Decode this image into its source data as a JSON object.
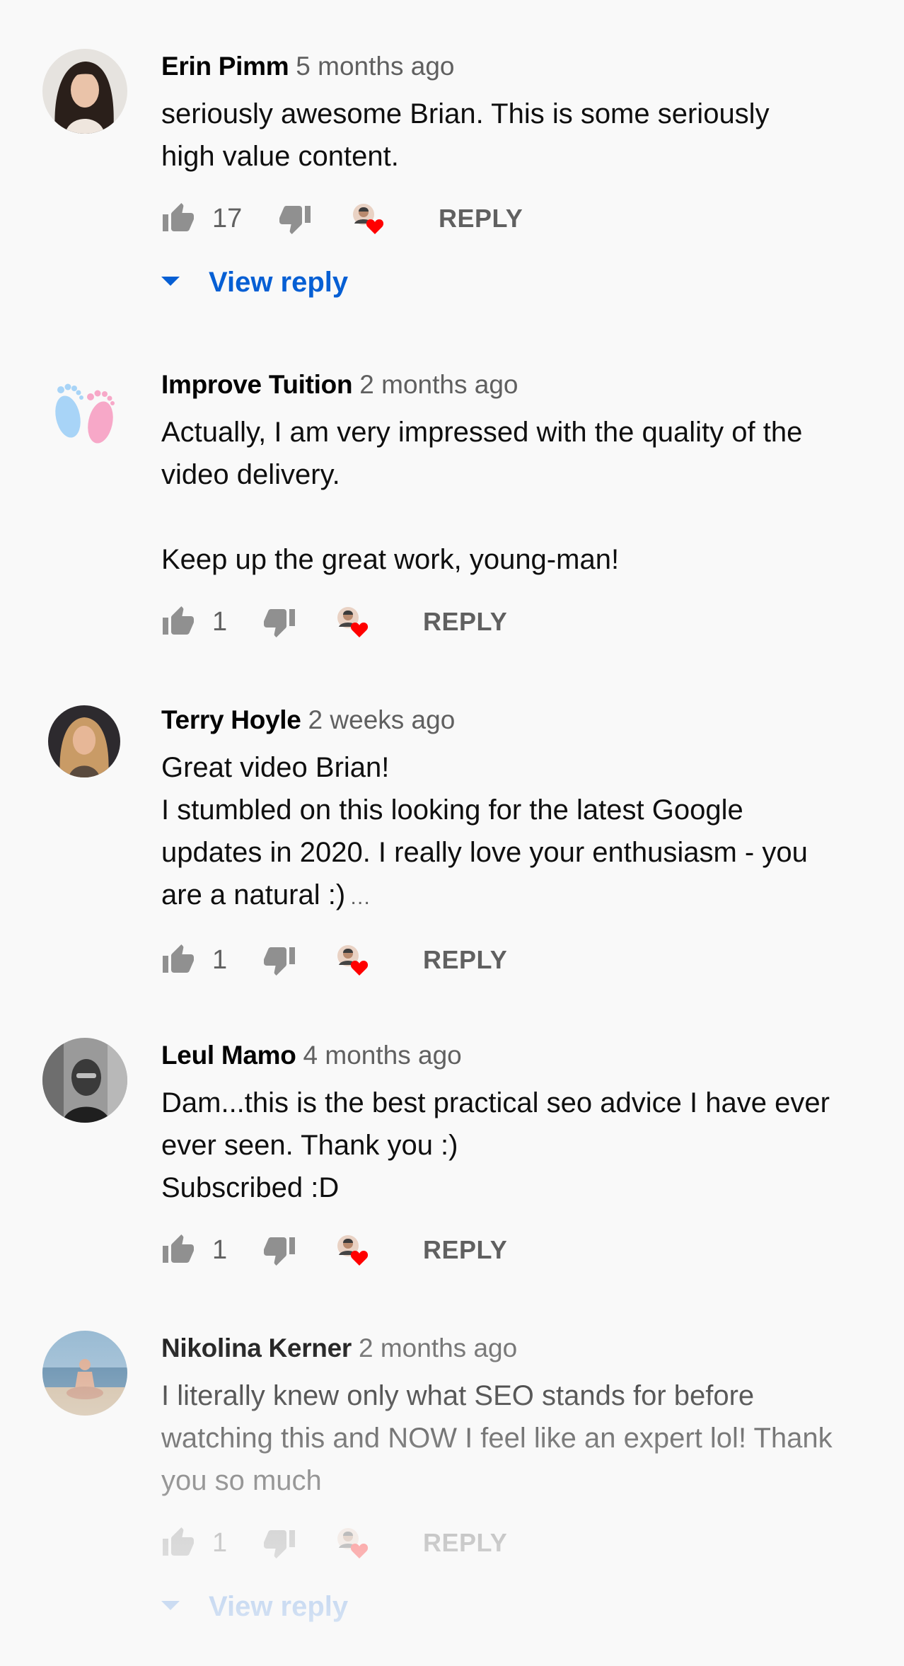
{
  "comments": [
    {
      "author": "Erin Pimm",
      "time": "5 months ago",
      "text": "seriously awesome Brian. This is some seriously\nhigh value content.",
      "more": "",
      "likes": "17",
      "reply_label": "REPLY",
      "view_reply": "View reply"
    },
    {
      "author": "Improve Tuition",
      "time": "2 months ago",
      "text": "Actually, I am very impressed with the quality of the\nvideo delivery.\n\nKeep up the great work, young-man!",
      "more": "",
      "likes": "1",
      "reply_label": "REPLY"
    },
    {
      "author": "Terry Hoyle",
      "time": "2 weeks ago",
      "text": "Great video Brian!\nI stumbled on this looking for the latest Google\nupdates in 2020. I really love your enthusiasm - you\nare a natural :)",
      "more": "…",
      "likes": "1",
      "reply_label": "REPLY"
    },
    {
      "author": "Leul Mamo",
      "time": "4 months ago",
      "text": "Dam...this is the best practical seo advice I have ever\never seen. Thank you :)\nSubscribed :D",
      "more": "",
      "likes": "1",
      "reply_label": "REPLY"
    },
    {
      "author": "Nikolina Kerner",
      "time": "2 months ago",
      "text": "I literally knew only what SEO stands for before\nwatching this and NOW I feel like an expert lol! Thank\nyou so much",
      "more": "",
      "likes": "1",
      "reply_label": "REPLY",
      "view_reply": "View reply"
    }
  ],
  "colors": {
    "background": "#f9f9f9",
    "link_blue": "#065fd4",
    "heart_red": "#ff0000",
    "secondary_text": "#606060"
  },
  "icons": {
    "like": "thumb-up-icon",
    "dislike": "thumb-down-icon",
    "creator_heart": "creator-heart-icon",
    "expand": "caret-down-icon"
  }
}
